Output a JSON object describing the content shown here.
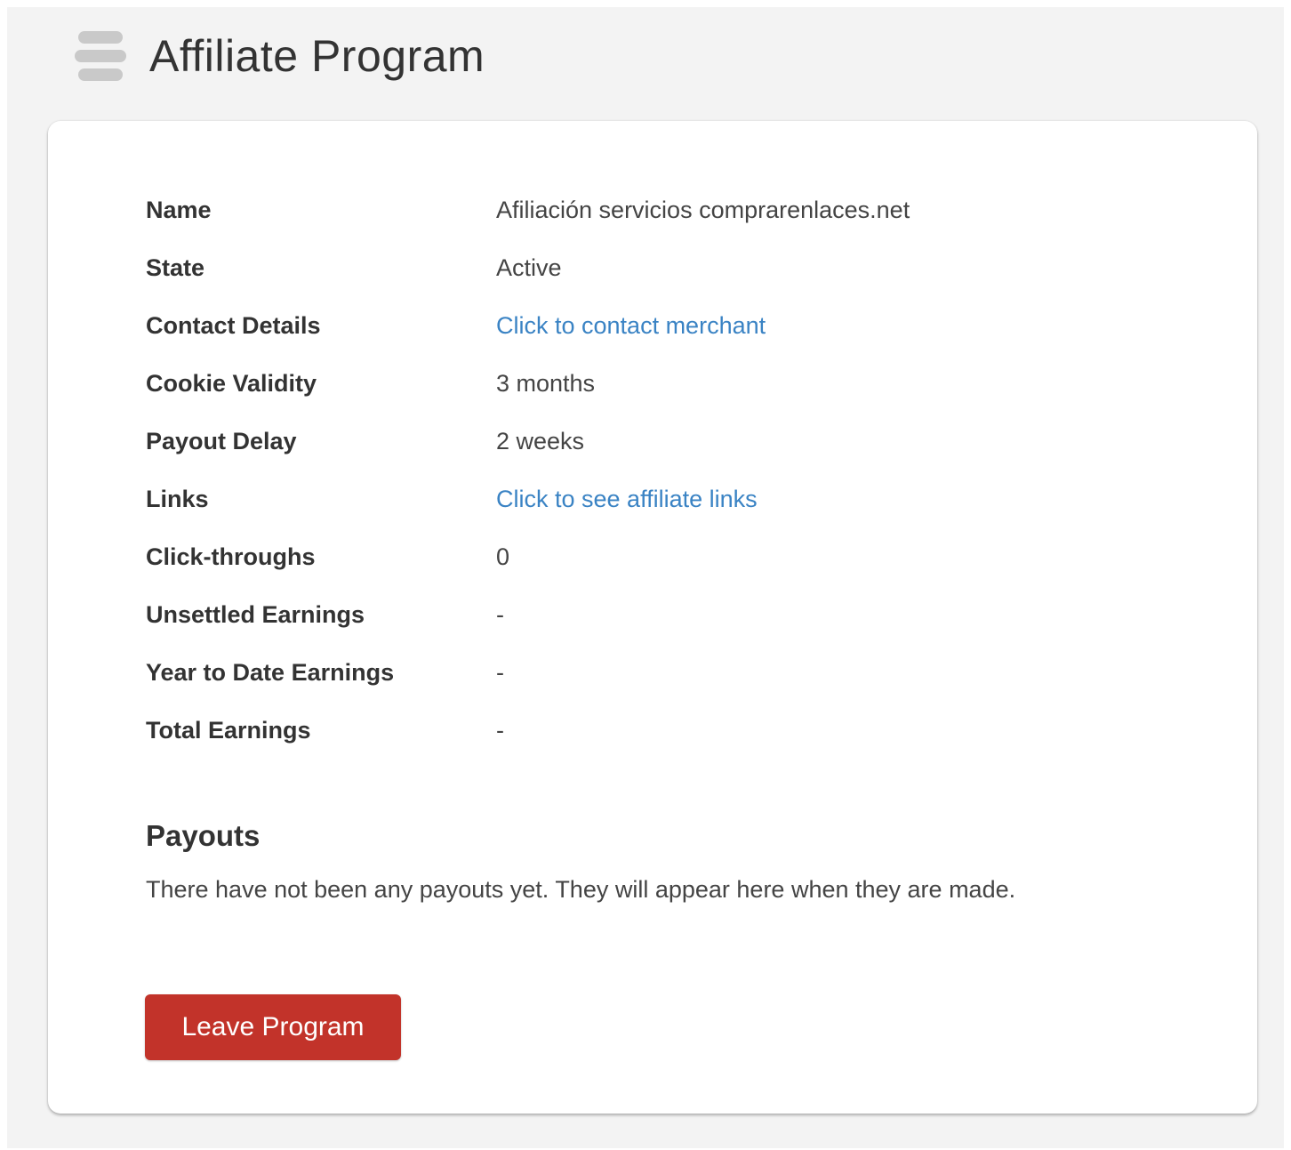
{
  "header": {
    "title": "Affiliate Program",
    "icon": "database-stack-icon"
  },
  "details": {
    "rows": [
      {
        "label": "Name",
        "value": "Afiliación servicios comprarenlaces.net"
      },
      {
        "label": "State",
        "value": "Active"
      },
      {
        "label": "Contact Details",
        "value": "Click to contact merchant"
      },
      {
        "label": "Cookie Validity",
        "value": "3 months"
      },
      {
        "label": "Payout Delay",
        "value": "2 weeks"
      },
      {
        "label": "Links",
        "value": "Click to see affiliate links"
      },
      {
        "label": "Click-throughs",
        "value": "0"
      },
      {
        "label": "Unsettled Earnings",
        "value": "-"
      },
      {
        "label": "Year to Date Earnings",
        "value": "-"
      },
      {
        "label": "Total Earnings",
        "value": "-"
      }
    ]
  },
  "payouts": {
    "heading": "Payouts",
    "empty_message": "There have not been any payouts yet. They will appear here when they are made."
  },
  "actions": {
    "leave_label": "Leave Program"
  },
  "colors": {
    "link": "#3a83c4",
    "danger_button": "#c2332a",
    "page_background": "#f3f3f3"
  }
}
